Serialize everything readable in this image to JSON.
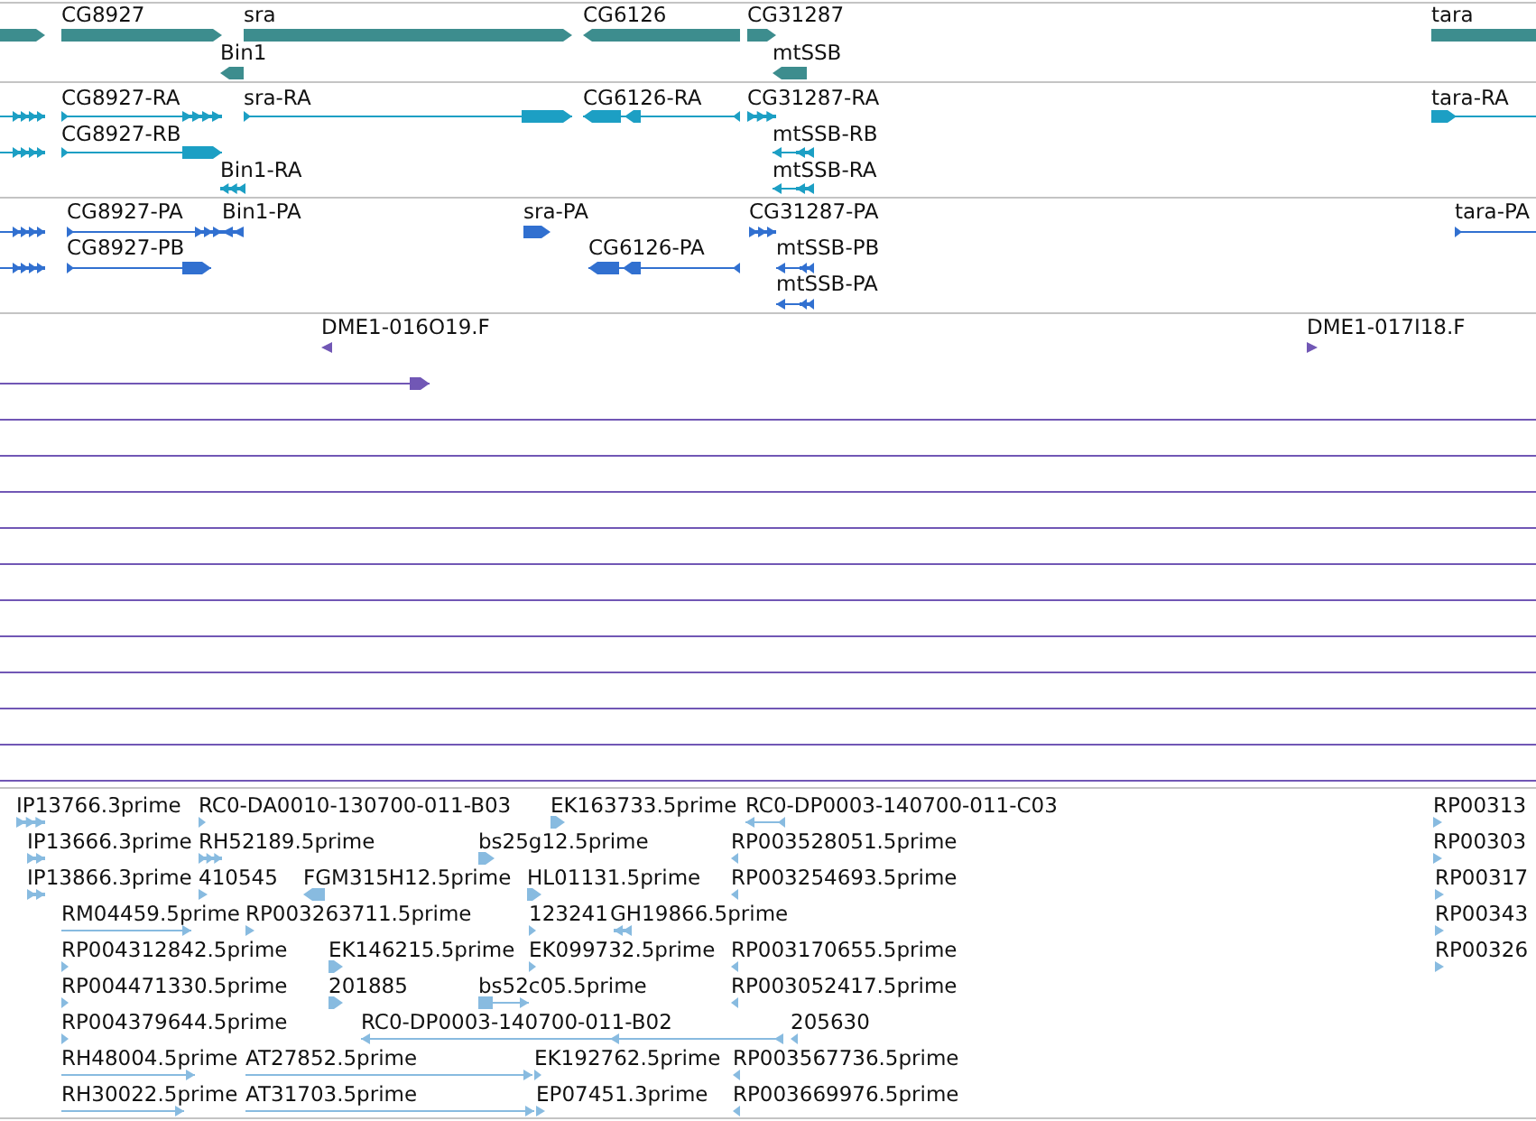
{
  "tracks": [
    {
      "color": "#3d8d8e",
      "features": [
        {
          "reverse": false
        },
        {
          "label": "CG8927",
          "reverse": false
        },
        {
          "label": "sra",
          "reverse": false
        },
        {
          "label": "CG6126",
          "reverse": true
        },
        {
          "label": "CG31287",
          "reverse": false
        },
        {
          "label": "tara",
          "reverse": false
        },
        {
          "label": "Bin1",
          "reverse": true
        },
        {
          "label": "mtSSB",
          "reverse": true
        }
      ]
    },
    {
      "color": "#1c9fc4",
      "features": [
        {
          "reverse": false
        },
        {
          "label": "CG8927-RA",
          "reverse": false
        },
        {
          "label": "sra-RA",
          "reverse": false
        },
        {
          "label": "CG6126-RA",
          "reverse": true
        },
        {
          "label": "CG31287-RA",
          "reverse": false
        },
        {
          "label": "tara-RA",
          "reverse": false
        },
        {
          "reverse": false
        },
        {
          "label": "CG8927-RB",
          "reverse": false
        },
        {
          "label": "mtSSB-RB",
          "reverse": true
        },
        {
          "label": "Bin1-RA",
          "reverse": true
        },
        {
          "label": "mtSSB-RA",
          "reverse": true
        }
      ]
    },
    {
      "color": "#3170d0",
      "features": [
        {
          "reverse": false
        },
        {
          "label": "CG8927-PA",
          "reverse": false
        },
        {
          "label": "Bin1-PA",
          "reverse": true
        },
        {
          "label": "sra-PA",
          "reverse": false
        },
        {
          "label": "CG31287-PA",
          "reverse": false
        },
        {
          "label": "tara-PA",
          "reverse": false
        },
        {
          "reverse": false
        },
        {
          "label": "CG8927-PB",
          "reverse": false
        },
        {
          "label": "CG6126-PA",
          "reverse": true
        },
        {
          "label": "mtSSB-PB",
          "reverse": true
        },
        {
          "label": "mtSSB-PA",
          "reverse": true
        }
      ]
    },
    {
      "color": "#7157b5",
      "features": [
        {
          "label": "DME1-016O19.F",
          "kind": "end",
          "reverse": true
        },
        {
          "label": "DME1-017I18.F",
          "kind": "end",
          "reverse": false
        },
        {
          "kind": "read",
          "reverse": false
        },
        {
          "kind": "span"
        },
        {
          "kind": "span"
        },
        {
          "kind": "span"
        },
        {
          "kind": "span"
        },
        {
          "kind": "span"
        },
        {
          "kind": "span"
        },
        {
          "kind": "span"
        },
        {
          "kind": "span"
        },
        {
          "kind": "span"
        },
        {
          "kind": "span"
        },
        {
          "kind": "span"
        }
      ]
    },
    {
      "color": "#88bbe0",
      "features": [
        {
          "label": "IP13766.3prime",
          "reverse": false
        },
        {
          "label": "RC0-DA0010-130700-011-B03",
          "reverse": false
        },
        {
          "label": "EK163733.5prime",
          "reverse": false
        },
        {
          "label": "RC0-DP0003-140700-011-C03",
          "reverse": true
        },
        {
          "label": "RP00313",
          "reverse": false
        },
        {
          "label": "IP13666.3prime",
          "reverse": false
        },
        {
          "label": "RH52189.5prime",
          "reverse": false
        },
        {
          "label": "bs25g12.5prime",
          "reverse": false
        },
        {
          "label": "RP003528051.5prime",
          "reverse": true
        },
        {
          "label": "RP00303",
          "reverse": false
        },
        {
          "label": "IP13866.3prime",
          "reverse": false
        },
        {
          "label": "410545",
          "reverse": false
        },
        {
          "label": "FGM315H12.5prime",
          "reverse": true
        },
        {
          "label": "HL01131.5prime",
          "reverse": false
        },
        {
          "label": "RP003254693.5prime",
          "reverse": true
        },
        {
          "label": "RP00317",
          "reverse": false
        },
        {
          "label": "RM04459.5prime",
          "reverse": false
        },
        {
          "label": "RP003263711.5prime",
          "reverse": false
        },
        {
          "label": "123241",
          "reverse": false
        },
        {
          "label": "GH19866.5prime",
          "reverse": true
        },
        {
          "label": "RP00343",
          "reverse": false
        },
        {
          "label": "RP004312842.5prime",
          "reverse": false
        },
        {
          "label": "EK146215.5prime",
          "reverse": false
        },
        {
          "label": "EK099732.5prime",
          "reverse": false
        },
        {
          "label": "RP003170655.5prime",
          "reverse": true
        },
        {
          "label": "RP00326",
          "reverse": false
        },
        {
          "label": "RP004471330.5prime",
          "reverse": false
        },
        {
          "label": "201885",
          "reverse": false
        },
        {
          "label": "bs52c05.5prime",
          "reverse": false
        },
        {
          "label": "RP003052417.5prime",
          "reverse": true
        },
        {
          "label": "RP004379644.5prime",
          "reverse": false
        },
        {
          "label": "RC0-DP0003-140700-011-B02",
          "reverse": true
        },
        {
          "label": "205630",
          "reverse": true
        },
        {
          "label": "RH48004.5prime",
          "reverse": false
        },
        {
          "label": "AT27852.5prime",
          "reverse": false
        },
        {
          "label": "EK192762.5prime",
          "reverse": false
        },
        {
          "label": "RP003567736.5prime",
          "reverse": true
        },
        {
          "label": "RH30022.5prime",
          "reverse": false
        },
        {
          "label": "AT31703.5prime",
          "reverse": false
        },
        {
          "label": "EP07451.3prime",
          "reverse": false
        },
        {
          "label": "RP003669976.5prime",
          "reverse": true
        }
      ]
    }
  ]
}
